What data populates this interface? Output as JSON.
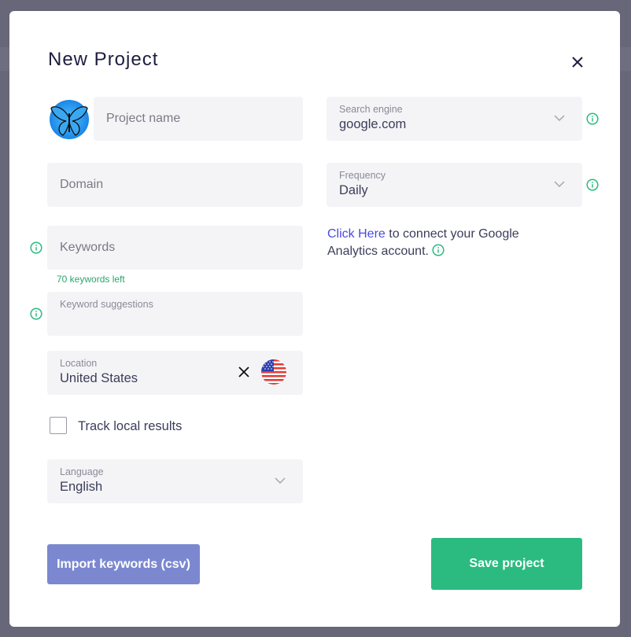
{
  "dialog": {
    "title": "New Project",
    "close_icon": "close-icon"
  },
  "left": {
    "avatar_icon": "butterfly-icon",
    "project_name": {
      "placeholder": "Project name",
      "value": ""
    },
    "domain": {
      "placeholder": "Domain",
      "value": ""
    },
    "keywords": {
      "placeholder": "Keywords",
      "value": "",
      "remaining": "70 keywords left"
    },
    "keyword_suggestions": {
      "label": "Keyword suggestions",
      "value": ""
    },
    "location": {
      "label": "Location",
      "value": "United States",
      "flag_icon": "us-flag-icon"
    },
    "track_local": {
      "label": "Track local results",
      "checked": false
    },
    "language": {
      "label": "Language",
      "value": "English"
    }
  },
  "right": {
    "search_engine": {
      "label": "Search engine",
      "value": "google.com"
    },
    "frequency": {
      "label": "Frequency",
      "value": "Daily"
    },
    "analytics": {
      "link_text": "Click Here",
      "rest_text": " to connect your Google Analytics account. "
    }
  },
  "buttons": {
    "import": "Import keywords (csv)",
    "save": "Save project"
  },
  "colors": {
    "primary_green": "#2bbb80",
    "import_button": "#7b88d0",
    "link": "#4a4ae0",
    "title": "#1c1d40"
  }
}
